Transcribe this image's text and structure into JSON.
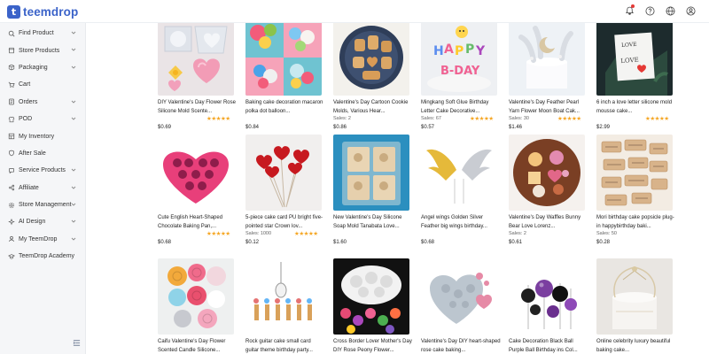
{
  "brand": {
    "logo_mark": "t",
    "name": "teemdrop",
    "accent": "#3b63c9"
  },
  "topbar": {
    "icons": [
      "bell-icon",
      "help-icon",
      "globe-icon",
      "user-icon"
    ]
  },
  "sidebar": {
    "items": [
      {
        "label": "Find Product",
        "icon": "search-icon",
        "chevron": true
      },
      {
        "label": "Store Products",
        "icon": "store-icon",
        "chevron": true
      },
      {
        "label": "Packaging",
        "icon": "box-icon",
        "chevron": true
      },
      {
        "label": "Cart",
        "icon": "cart-icon",
        "chevron": false
      },
      {
        "label": "Orders",
        "icon": "orders-icon",
        "chevron": true
      },
      {
        "label": "POD",
        "icon": "pod-icon",
        "chevron": true
      },
      {
        "label": "My Inventory",
        "icon": "inventory-icon",
        "chevron": false
      },
      {
        "label": "After Sale",
        "icon": "after-sale-icon",
        "chevron": false
      },
      {
        "label": "Service Products",
        "icon": "service-icon",
        "chevron": true
      },
      {
        "label": "Affiliate",
        "icon": "affiliate-icon",
        "chevron": true
      },
      {
        "label": "Store Management",
        "icon": "settings-icon",
        "chevron": true
      },
      {
        "label": "AI Design",
        "icon": "ai-icon",
        "chevron": true
      },
      {
        "label": "My TeemDrop",
        "icon": "user-icon",
        "chevron": true
      },
      {
        "label": "TeemDrop Academy",
        "icon": "academy-icon",
        "chevron": false
      }
    ],
    "collapse_icon": "collapse-icon"
  },
  "products": [
    {
      "name": "DIY Valentine's Day Flower Rose Silicone Mold Scente...",
      "sales": "",
      "stars": "★★★★★",
      "price": "$0.69",
      "art": "pink-molds"
    },
    {
      "name": "Baking cake decoration macaron polka dot balloon...",
      "sales": "",
      "stars": "",
      "price": "$0.84",
      "art": "balloons"
    },
    {
      "name": "Valentine's Day Cartoon Cookie Molds, Various Hear...",
      "sales": "Sales: 2",
      "stars": "",
      "price": "$0.86",
      "art": "cookies"
    },
    {
      "name": "Mingkang Soft Glue Birthday Letter Cake Decorative...",
      "sales": "Sales: 67",
      "stars": "★★★★★",
      "price": "$0.57",
      "art": "happy-bday"
    },
    {
      "name": "Valentine's Day Feather Pearl Yarn Flower Moon Boat Cak...",
      "sales": "Sales: 30",
      "stars": "★★★★★",
      "price": "$1.46",
      "art": "feather-cake"
    },
    {
      "name": "6 inch a love letter silicone mold mousse cake...",
      "sales": "",
      "stars": "★★★★★",
      "price": "$2.99",
      "art": "love-letter"
    },
    {
      "name": "Cute English Heart-Shaped Chocolate Baking Pan,...",
      "sales": "",
      "stars": "★★★★★",
      "price": "$0.68",
      "art": "heart-pan"
    },
    {
      "name": "5-piece cake card PU bright five-pointed star Crown lov...",
      "sales": "Sales: 1000",
      "stars": "★★★★★",
      "price": "$0.12",
      "art": "heart-picks"
    },
    {
      "name": "New Valentine's Day Silicone Soap Mold Tanabata Love...",
      "sales": "",
      "stars": "",
      "price": "$1.60",
      "art": "soap-mold"
    },
    {
      "name": "Angel wings Golden Silver Feather big wings birthday...",
      "sales": "",
      "stars": "",
      "price": "$0.68",
      "art": "wings"
    },
    {
      "name": "Valentine's Day Waffles Bunny Bear Love Lorenz...",
      "sales": "Sales: 2",
      "stars": "",
      "price": "$0.61",
      "art": "waffles"
    },
    {
      "name": "Mori birthday cake popsicle plug-in happybirthday baki...",
      "sales": "Sales: 50",
      "stars": "",
      "price": "$0.28",
      "art": "kraft-tags"
    },
    {
      "name": "Caifu Valentine's Day Flower Scented Candle Silicone...",
      "sales": "",
      "stars": "",
      "price": "",
      "art": "flower-candles"
    },
    {
      "name": "Rock guitar cake small card guitar theme birthday party...",
      "sales": "",
      "stars": "",
      "price": "",
      "art": "guitar"
    },
    {
      "name": "Cross Border Lover Mother's Day DIY Rose Peony Flower...",
      "sales": "",
      "stars": "",
      "price": "",
      "art": "peony-mold"
    },
    {
      "name": "Valentine's Day DIY heart-shaped rose cake baking...",
      "sales": "",
      "stars": "",
      "price": "",
      "art": "rose-heart"
    },
    {
      "name": "Cake Decoration Black Ball Purple Ball Birthday ins Col...",
      "sales": "",
      "stars": "",
      "price": "",
      "art": "balls"
    },
    {
      "name": "Online celebrity luxury beautiful baking cake...",
      "sales": "",
      "stars": "",
      "price": "",
      "art": "luxury-cake"
    }
  ]
}
